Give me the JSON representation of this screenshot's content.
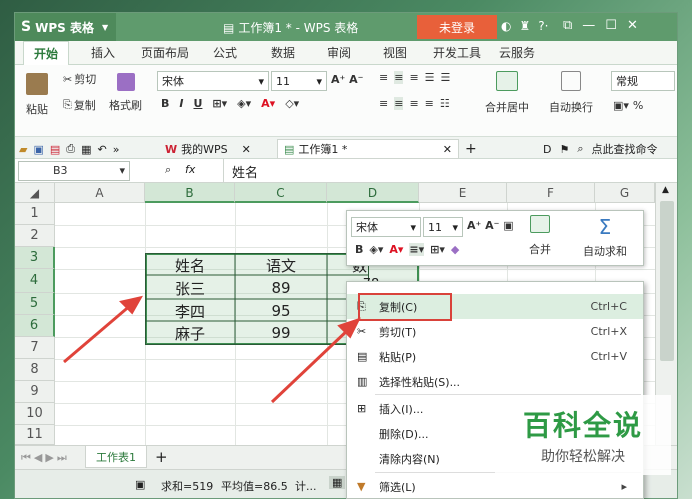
{
  "app": {
    "name": "WPS 表格",
    "logo": "S",
    "doc_title": "工作簿1 * - WPS 表格",
    "login": "未登录"
  },
  "tabs": [
    "开始",
    "插入",
    "页面布局",
    "公式",
    "数据",
    "审阅",
    "视图",
    "开发工具",
    "云服务"
  ],
  "ribbon": {
    "paste": "粘贴",
    "cut": "剪切",
    "copy": "复制",
    "format_painter": "格式刷",
    "font": "宋体",
    "size": "11",
    "merge": "合并居中",
    "wrap": "自动换行",
    "number_format": "常规",
    "percent": "%"
  },
  "quickaccess": {
    "mywps": "我的WPS",
    "workbook_tab": "工作簿1 *",
    "search": "点此查找命令"
  },
  "formula": {
    "cell_ref": "B3",
    "fx": "fx",
    "content": "姓名"
  },
  "grid": {
    "columns": [
      "A",
      "B",
      "C",
      "D",
      "E",
      "F",
      "G"
    ],
    "rows": [
      "1",
      "2",
      "3",
      "4",
      "5",
      "6",
      "7",
      "8",
      "9",
      "10",
      "11"
    ],
    "cells": {
      "B3": "姓名",
      "C3": "语文",
      "D3": "数",
      "B4": "张三",
      "C4": "89",
      "D4": "78",
      "B5": "李四",
      "C5": "95",
      "B6": "麻子",
      "C6": "99"
    }
  },
  "sheet": {
    "name": "工作表1",
    "add": "+"
  },
  "status": {
    "sum": "求和=519",
    "avg": "平均值=86.5",
    "count": "计..."
  },
  "minitoolbar": {
    "font": "宋体",
    "size": "11",
    "merge": "合并",
    "autosum": "自动求和"
  },
  "context_menu": [
    {
      "label": "复制(C)",
      "key": "Ctrl+C",
      "icon": "copy-icon"
    },
    {
      "label": "剪切(T)",
      "key": "Ctrl+X",
      "icon": "cut-icon"
    },
    {
      "label": "粘贴(P)",
      "key": "Ctrl+V",
      "icon": "paste-icon"
    },
    {
      "label": "选择性粘贴(S)...",
      "key": "",
      "icon": "paste-special-icon"
    },
    {
      "label": "插入(I)...",
      "key": "",
      "icon": "insert-icon"
    },
    {
      "label": "删除(D)...",
      "key": "",
      "icon": "delete-icon"
    },
    {
      "label": "清除内容(N)",
      "key": "",
      "icon": "clear-icon"
    },
    {
      "label": "筛选(L)",
      "key": "",
      "icon": "filter-icon"
    }
  ],
  "watermark": {
    "title": "百科全说",
    "subtitle": "助你轻松解决"
  },
  "colors": {
    "accent": "#5f9b6d",
    "selection": "#3f8f52",
    "highlight_box": "#d9423a",
    "arrow": "#e0433a",
    "login": "#e8603a"
  }
}
